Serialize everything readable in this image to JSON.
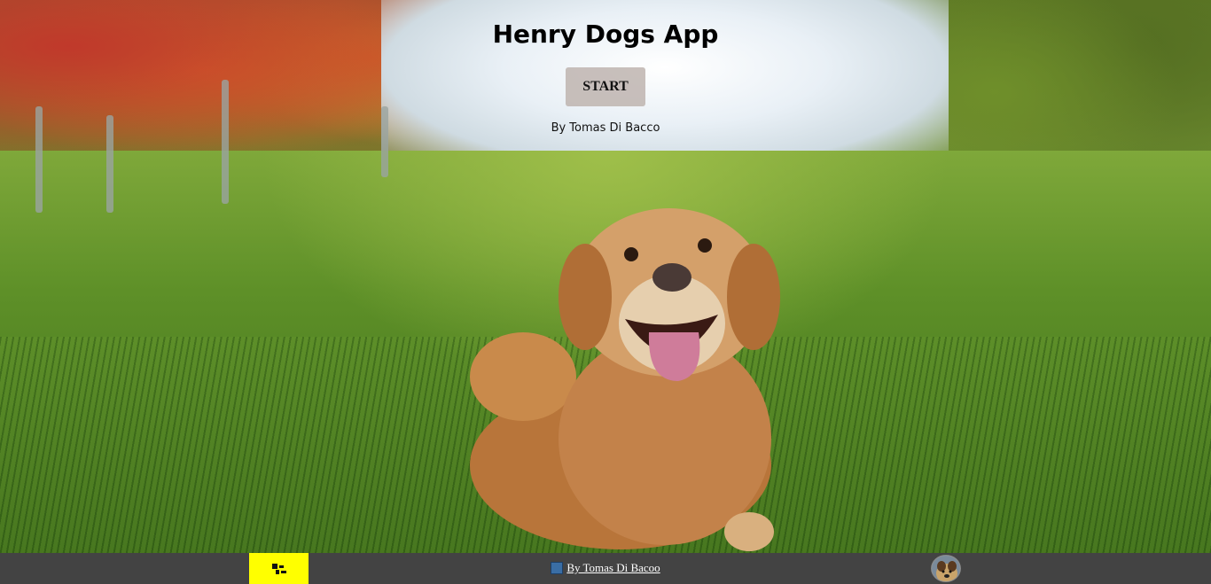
{
  "header": {
    "title": "Henry Dogs App",
    "start_label": "START",
    "byline": "By Tomas Di Bacco"
  },
  "footer": {
    "link_label": "By Tomas Di Bacoo",
    "logo_color": "#ffff00",
    "background_color": "#434343"
  },
  "icons": [
    "logo-icon",
    "link-icon",
    "avatar"
  ]
}
